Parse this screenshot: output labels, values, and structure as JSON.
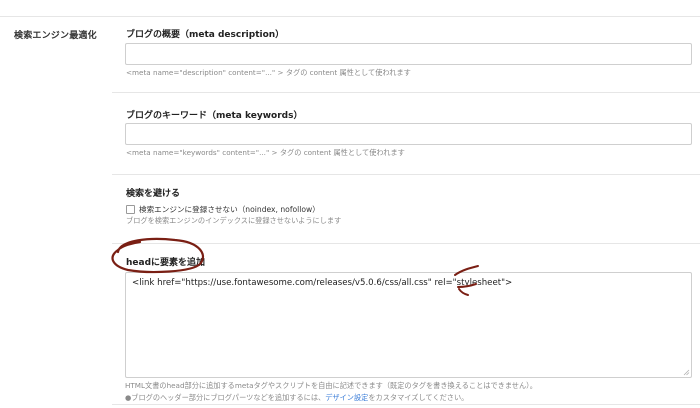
{
  "sidebar": {
    "section_label": "検索エンジン最適化"
  },
  "meta_description": {
    "title": "ブログの概要（meta description）",
    "value": "",
    "help": "<meta name=\"description\" content=\"...\" > タグの content 属性として使われます"
  },
  "meta_keywords": {
    "title": "ブログのキーワード（meta keywords）",
    "value": "",
    "help": "<meta name=\"keywords\" content=\"...\" > タグの content 属性として使われます"
  },
  "avoid_search": {
    "title": "検索を避ける",
    "checkbox_label": "検索エンジンに登録させない（noindex, nofollow）",
    "checked": false,
    "help": "ブログを検索エンジンのインデックスに登録させないようにします"
  },
  "head_elements": {
    "title": "headに要素を追加",
    "value": "<link href=\"https://use.fontawesome.com/releases/v5.0.6/css/all.css\" rel=\"stylesheet\">",
    "help_line1": "HTML文書のhead部分に追加するmetaタグやスクリプトを自由に記述できます（既定のタグを書き換えることはできません）。",
    "help_line2_prefix": "●ブログのヘッダー部分にブログパーツなどを追加するには、",
    "help_line2_link": "デザイン設定",
    "help_line2_suffix": "をカスタマイズしてください。"
  },
  "colors": {
    "annotation": "#7a1f14",
    "link": "#3b7dd8"
  }
}
